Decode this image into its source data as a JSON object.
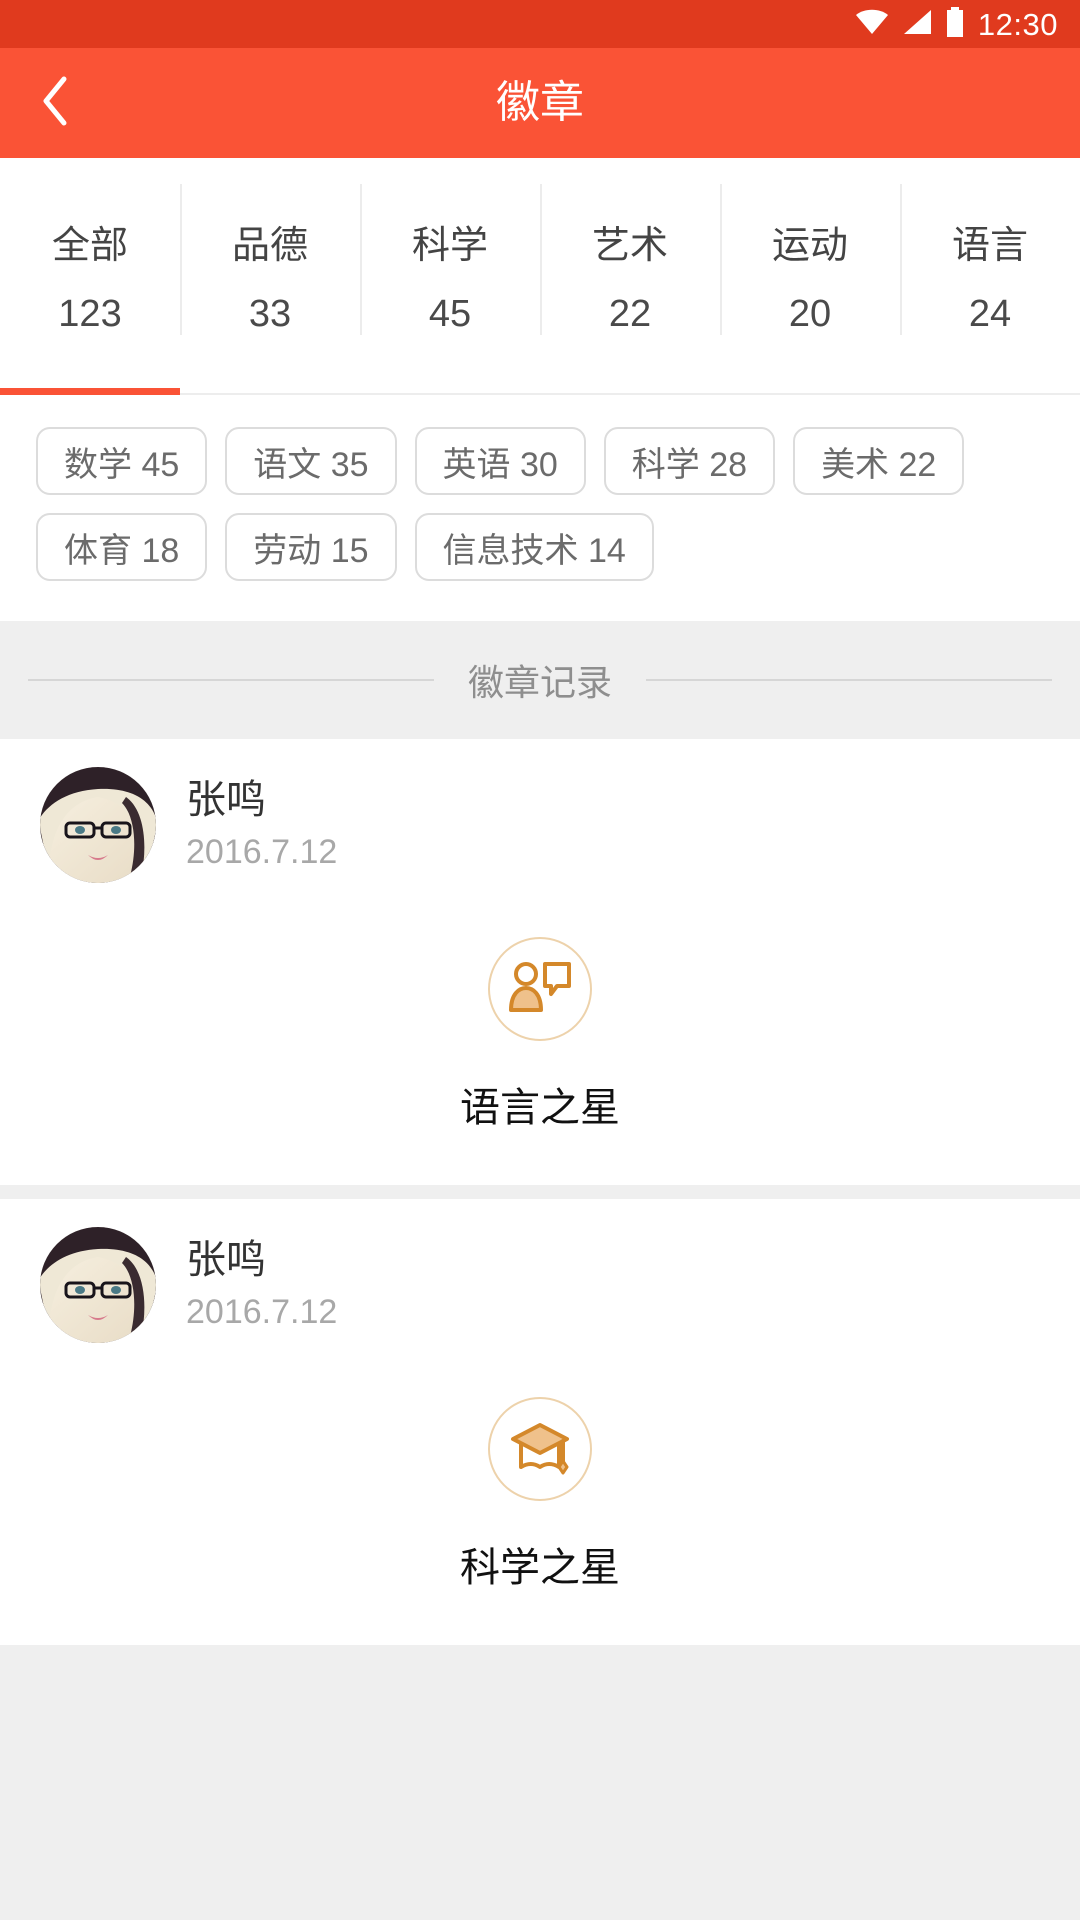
{
  "statusbar": {
    "time": "12:30",
    "icons": [
      "wifi-icon",
      "signal-icon",
      "battery-icon"
    ]
  },
  "appbar": {
    "title": "徽章",
    "back_icon": "chevron-left-icon",
    "bg_color": "#FA5336"
  },
  "tabs": {
    "active_index": 0,
    "items": [
      {
        "label": "全部",
        "count": "123"
      },
      {
        "label": "品德",
        "count": "33"
      },
      {
        "label": "科学",
        "count": "45"
      },
      {
        "label": "艺术",
        "count": "22"
      },
      {
        "label": "运动",
        "count": "20"
      },
      {
        "label": "语言",
        "count": "24"
      }
    ]
  },
  "chips": [
    {
      "label": "数学 45"
    },
    {
      "label": "语文 35"
    },
    {
      "label": "英语 30"
    },
    {
      "label": "科学 28"
    },
    {
      "label": "美术 22"
    },
    {
      "label": "体育 18"
    },
    {
      "label": "劳动 15"
    },
    {
      "label": "信息技术 14"
    }
  ],
  "section": {
    "title": "徽章记录"
  },
  "records": [
    {
      "name": "张鸣",
      "date": "2016.7.12",
      "avatar": "user-photo-avatar",
      "badge_icon": "person-speech-bubble-icon",
      "badge_name": "语言之星"
    },
    {
      "name": "张鸣",
      "date": "2016.7.12",
      "avatar": "user-photo-avatar",
      "badge_icon": "graduation-cap-icon",
      "badge_name": "科学之星"
    }
  ],
  "colors": {
    "status_bar": "#E03A1E",
    "accent": "#FA5336",
    "badge_orange": "#D4882A",
    "badge_fill": "#EFC18B",
    "page_bg": "#EFEFEF"
  }
}
